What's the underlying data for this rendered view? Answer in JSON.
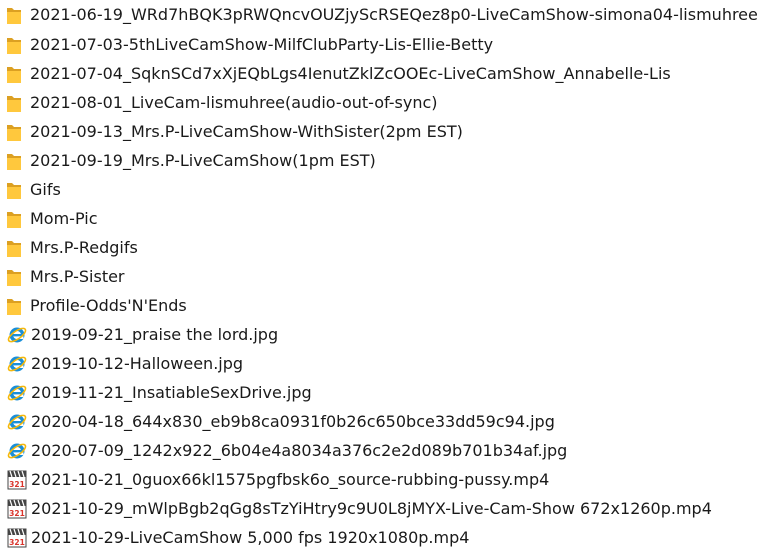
{
  "items": [
    {
      "type": "folder",
      "icon": "folder-icon",
      "name": "2021-06-19_WRd7hBQK3pRWQncvOUZjyScRSEQez8p0-LiveCamShow-simona04-lismuhree"
    },
    {
      "type": "folder",
      "icon": "folder-icon",
      "name": "2021-07-03-5thLiveCamShow-MilfClubParty-Lis-Ellie-Betty"
    },
    {
      "type": "folder",
      "icon": "folder-icon",
      "name": "2021-07-04_SqknSCd7xXjEQbLgs4IenutZklZcOOEc-LiveCamShow_Annabelle-Lis"
    },
    {
      "type": "folder",
      "icon": "folder-icon",
      "name": "2021-08-01_LiveCam-lismuhree(audio-out-of-sync)"
    },
    {
      "type": "folder",
      "icon": "folder-icon",
      "name": "2021-09-13_Mrs.P-LiveCamShow-WithSister(2pm EST)"
    },
    {
      "type": "folder",
      "icon": "folder-icon",
      "name": "2021-09-19_Mrs.P-LiveCamShow(1pm EST)"
    },
    {
      "type": "folder",
      "icon": "folder-icon",
      "name": "Gifs"
    },
    {
      "type": "folder",
      "icon": "folder-icon",
      "name": "Mom-Pic"
    },
    {
      "type": "folder",
      "icon": "folder-icon",
      "name": "Mrs.P-Redgifs"
    },
    {
      "type": "folder",
      "icon": "folder-icon",
      "name": "Mrs.P-Sister"
    },
    {
      "type": "folder",
      "icon": "folder-icon",
      "name": "Profile-Odds'N'Ends"
    },
    {
      "type": "image",
      "icon": "internet-explorer-icon",
      "name": "2019-09-21_praise the lord.jpg"
    },
    {
      "type": "image",
      "icon": "internet-explorer-icon",
      "name": "2019-10-12-Halloween.jpg"
    },
    {
      "type": "image",
      "icon": "internet-explorer-icon",
      "name": "2019-11-21_InsatiableSexDrive.jpg"
    },
    {
      "type": "image",
      "icon": "internet-explorer-icon",
      "name": "2020-04-18_644x830_eb9b8ca0931f0b26c650bce33dd59c94.jpg"
    },
    {
      "type": "image",
      "icon": "internet-explorer-icon",
      "name": "2020-07-09_1242x922_6b04e4a8034a376c2e2d089b701b34af.jpg"
    },
    {
      "type": "video",
      "icon": "media-player-classic-icon",
      "name": "2021-10-21_0guox66kl1575pgfbsk6o_source-rubbing-pussy.mp4"
    },
    {
      "type": "video",
      "icon": "media-player-classic-icon",
      "name": "2021-10-29_mWlpBgb2qGg8sTzYiHtry9c9U0L8jMYX-Live-Cam-Show 672x1260p.mp4"
    },
    {
      "type": "video",
      "icon": "media-player-classic-icon",
      "name": "2021-10-29-LiveCamShow 5,000 fps 1920x1080p.mp4"
    }
  ],
  "colors": {
    "folder_back": "#dca022",
    "folder_front": "#ffc83d",
    "ie_blue": "#1a8fd8",
    "ie_ring": "#f5b80b",
    "video_dark": "#444444",
    "video_accent": "#d9342b"
  }
}
